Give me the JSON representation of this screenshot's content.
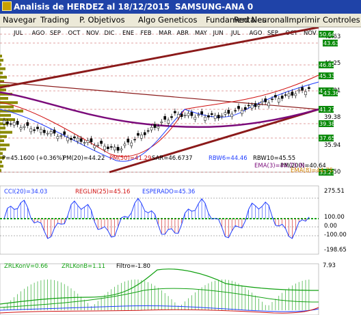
{
  "window": {
    "title": "Analisis de HERDEZ al 18/12/2015",
    "subtitle": "SAMSUNG-ANA 0"
  },
  "menu": [
    {
      "label": "Navegar"
    },
    {
      "label": "Trading"
    },
    {
      "label": "P. Objetivos"
    },
    {
      "label": "Algo Geneticos"
    },
    {
      "label": "Fundamentales"
    },
    {
      "label": "Red Neuronal"
    },
    {
      "label": "Imprimir"
    },
    {
      "label": "Controles"
    }
  ],
  "price_panel": {
    "months": [
      "JUL",
      "AGO",
      "SEP",
      "OCT",
      "NOV",
      "DIC",
      "ENE",
      "FEB",
      "MAR",
      "ABR",
      "MAY",
      "JUN",
      "JUL",
      "AGO",
      "SEP",
      "OCT",
      "NOV"
    ],
    "axis_labels": [
      "43.63",
      "46.25",
      "42.81",
      "39.38",
      "35.94",
      "32.50"
    ],
    "level_tags": [
      {
        "text": "50.64",
        "color": "#0a8a0a"
      },
      {
        "text": "43.63",
        "color": "#0a8a0a"
      },
      {
        "text": "46.85",
        "color": "#0a8a0a"
      },
      {
        "text": "45.33",
        "color": "#0a8a0a"
      },
      {
        "text": "43.50",
        "color": "#0a8a0a"
      },
      {
        "text": "43.36",
        "color": "#0a8a0a"
      },
      {
        "text": "41.27",
        "color": "#0a8a0a"
      },
      {
        "text": "39.38",
        "color": "#0a8a0a"
      },
      {
        "text": "37.65",
        "color": "#0a8a0a"
      },
      {
        "text": "33.23",
        "color": "#0a8a0a"
      }
    ],
    "info": {
      "p": "P=45.1600 (+0.36%)",
      "pm20": "PM(20)=44.22",
      "pm50": "PM(50)=41.29",
      "sar": "SAR=46.6737",
      "rbw6": "RBW6=44.46",
      "rbw10": "RBW10=45.55",
      "pm200": "PM(200)=40.64",
      "ema3": "EMA(3)=44.73 IN",
      "ema8": "EMA(8)=44.75"
    }
  },
  "cci_panel": {
    "labels": {
      "cci": "CCI(20)=34.03",
      "reglin": "REGLIN(25)=45.16",
      "esperado": "ESPERADO=45.36"
    },
    "axis_labels": [
      "275.51",
      "100.00",
      "0.00",
      "-100.00",
      "-198.65"
    ]
  },
  "zrl_panel": {
    "labels": {
      "conv": "ZRLKonV=0.66",
      "conb": "ZRLKonB=1.11",
      "filtro": "Filtro=-1.80"
    },
    "axis_labels": [
      "7.93"
    ]
  },
  "colors": {
    "title_bg": "#1f43a8",
    "menu_bg": "#ece9d8",
    "channel": "#8b1a1a",
    "ma_purple": "#7a0a7a",
    "ma_blue": "#1e3cff",
    "ma_red": "#d01010",
    "ma_green": "#10a010",
    "tag_green": "#0a8a0a"
  }
}
